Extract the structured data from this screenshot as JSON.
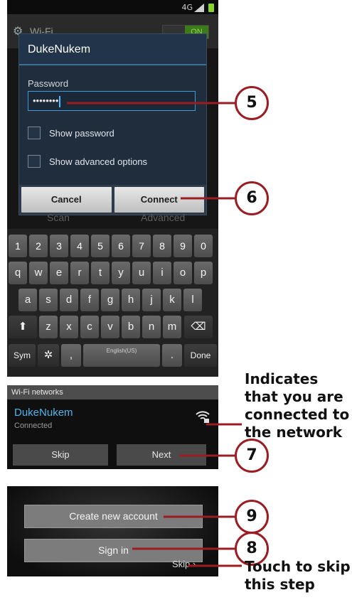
{
  "status_bar": {
    "signal_label": "4G"
  },
  "background_screen": {
    "title": "Wi-Fi",
    "toggle_label": "ON",
    "scan_label": "Scan",
    "advanced_label": "Advanced"
  },
  "dialog": {
    "network_name": "DukeNukem",
    "password_label": "Password",
    "password_value": "••••••••",
    "show_password_label": "Show password",
    "advanced_options_label": "Show advanced options",
    "cancel_label": "Cancel",
    "connect_label": "Connect"
  },
  "keyboard": {
    "row1": [
      "1",
      "2",
      "3",
      "4",
      "5",
      "6",
      "7",
      "8",
      "9",
      "0"
    ],
    "row2": [
      "q",
      "w",
      "e",
      "r",
      "t",
      "y",
      "u",
      "i",
      "o",
      "p"
    ],
    "row3": [
      "a",
      "s",
      "d",
      "f",
      "g",
      "h",
      "j",
      "k",
      "l"
    ],
    "row4": [
      "z",
      "x",
      "c",
      "v",
      "b",
      "n",
      "m"
    ],
    "sym_label": "Sym",
    "space_label": "English(US)",
    "period_label": ".",
    "comma_label": ",",
    "done_label": "Done",
    "shift_icon": "⬆",
    "delete_icon": "⌫",
    "settings_icon": "✲"
  },
  "wifi_networks": {
    "header": "Wi-Fi networks",
    "network_name": "DukeNukem",
    "network_status": "Connected",
    "skip_label": "Skip",
    "next_label": "Next"
  },
  "account_screen": {
    "create_label": "Create new account",
    "signin_label": "Sign in",
    "skip_label": "Skip"
  },
  "callouts": {
    "step5": "5",
    "step6": "6",
    "step7": "7",
    "step8": "8",
    "step9": "9",
    "connected_note": [
      "Indicates",
      "that you are",
      "connected to",
      "the network"
    ],
    "skip_note": [
      "Touch to skip",
      "this step"
    ]
  },
  "colors": {
    "callout_line": "#9b1c23",
    "accent_blue": "#3d9bd8",
    "network_text": "#4fb4ec"
  }
}
